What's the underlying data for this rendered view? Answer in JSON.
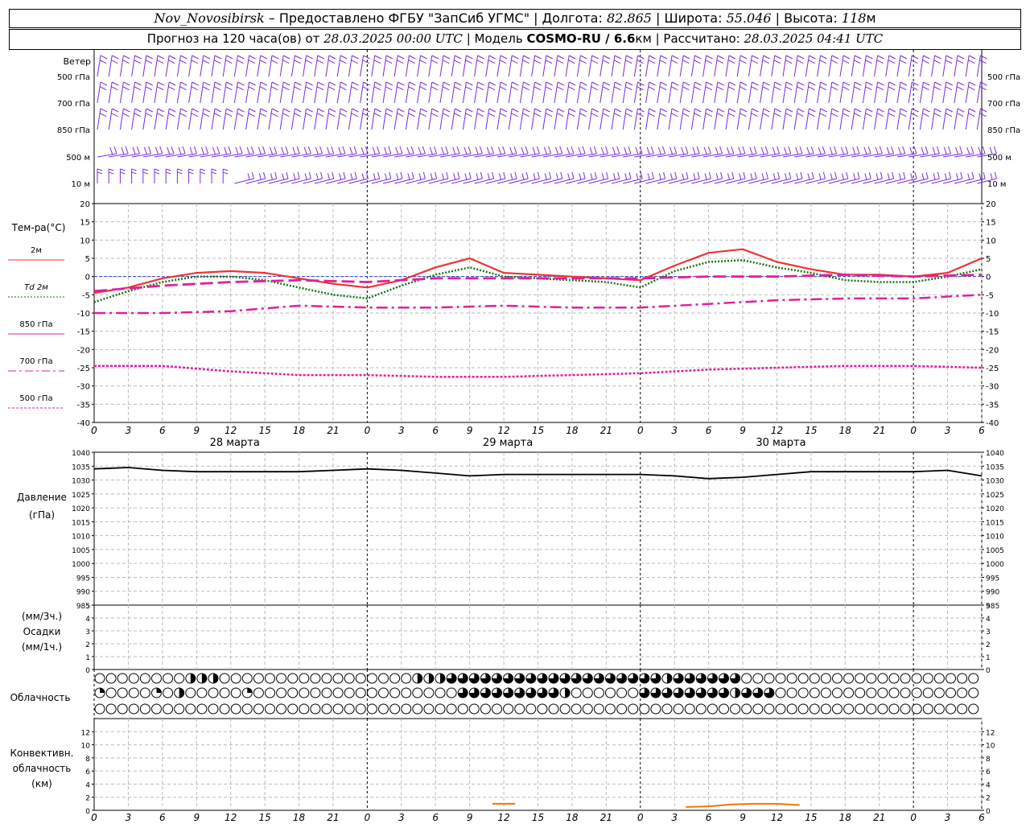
{
  "header": {
    "station": "Nov_Novosibirsk",
    "provider": " – Предоставлено ФГБУ \"ЗапСиб УГМС\" | Долгота: ",
    "lon": "82.865",
    "lat_label": " | Широта: ",
    "lat": "55.046",
    "alt_label": " | Высота: ",
    "alt": "118",
    "alt_unit": "м",
    "forecast_label": "Прогноз на 120 часа(ов) от ",
    "forecast_start": "28.03.2025 00:00 UTC",
    "model_label": " | Модель ",
    "model": "COSMO-RU / 6.6",
    "model_unit": "км",
    "computed_label": " | Рассчитано: ",
    "computed": "28.03.2025 04:41 UTC"
  },
  "labels": {
    "wind": "Ветер",
    "wind_levels": [
      "500 гПа",
      "700 гПа",
      "850 гПа",
      "500 м",
      "10 м"
    ],
    "temp": "Тем-ра(°C)",
    "legend": [
      "2м",
      "Td 2м",
      "850 гПа",
      "700 гПа",
      "500 гПа"
    ],
    "pressure": [
      "Давление",
      "(гПа)"
    ],
    "precip": [
      "(мм/3ч.)",
      "Осадки",
      "(мм/1ч.)"
    ],
    "cloud": "Облачность",
    "conv": [
      "Конвективн.",
      "облачность",
      "(км)"
    ]
  },
  "x_ticks": [
    "0",
    "3",
    "6",
    "9",
    "12",
    "15",
    "18",
    "21",
    "0",
    "3",
    "6",
    "9",
    "12",
    "15",
    "18",
    "21",
    "0",
    "3",
    "6",
    "9",
    "12",
    "15",
    "18",
    "21",
    "0",
    "3",
    "6"
  ],
  "dates": [
    "28 марта",
    "29 марта",
    "30 марта"
  ],
  "colors": {
    "wind": "#7a2be0",
    "t2m": "#ee3333",
    "td2m": "#117711",
    "t850": "#e0209a",
    "pressure": "#000000",
    "conv": "#ee7700"
  },
  "chart_data": [
    {
      "type": "line",
      "panel": "temperature",
      "ylim": [
        -40,
        20
      ],
      "yticks": [
        20,
        15,
        10,
        5,
        0,
        -5,
        -10,
        -15,
        -20,
        -25,
        -30,
        -35,
        -40
      ],
      "x_unit": "hours since 28.03.2025 00:00 UTC",
      "series": [
        {
          "name": "2м",
          "x": [
            0,
            3,
            6,
            9,
            12,
            15,
            18,
            21,
            24,
            27,
            30,
            33,
            36,
            39,
            42,
            45,
            48,
            51,
            54,
            57,
            60,
            63,
            66,
            69,
            72,
            75,
            78
          ],
          "values": [
            -4.5,
            -3.0,
            -0.5,
            1.0,
            1.5,
            1.0,
            -0.5,
            -2.0,
            -3.0,
            -1.0,
            2.5,
            5.0,
            1.0,
            0.5,
            0.0,
            -0.5,
            -1.0,
            3.0,
            6.5,
            7.5,
            4.0,
            2.0,
            0.5,
            0.5,
            0.0,
            1.0,
            5.0
          ]
        },
        {
          "name": "Td 2м",
          "x": [
            0,
            3,
            6,
            9,
            12,
            15,
            18,
            21,
            24,
            27,
            30,
            33,
            36,
            39,
            42,
            45,
            48,
            51,
            54,
            57,
            60,
            63,
            66,
            69,
            72,
            75,
            78
          ],
          "values": [
            -7.0,
            -4.0,
            -1.5,
            0.0,
            0.0,
            -1.0,
            -3.0,
            -5.0,
            -6.0,
            -2.5,
            0.5,
            2.5,
            0.0,
            -0.5,
            -1.0,
            -1.5,
            -3.0,
            1.5,
            4.0,
            4.5,
            2.5,
            1.0,
            -1.0,
            -1.5,
            -1.5,
            0.0,
            2.0
          ]
        },
        {
          "name": "850 гПа",
          "x": [
            0,
            6,
            12,
            18,
            24,
            30,
            36,
            42,
            48,
            54,
            60,
            66,
            72,
            78
          ],
          "values": [
            -4.0,
            -2.5,
            -1.5,
            -1.0,
            -1.5,
            -0.5,
            -0.5,
            -0.5,
            -0.5,
            0.0,
            0.0,
            0.5,
            0.0,
            0.5
          ]
        },
        {
          "name": "700 гПа",
          "x": [
            0,
            6,
            12,
            18,
            24,
            30,
            36,
            42,
            48,
            54,
            60,
            66,
            72,
            78
          ],
          "values": [
            -10.0,
            -10.0,
            -9.5,
            -8.0,
            -8.5,
            -8.5,
            -8.0,
            -8.5,
            -8.5,
            -7.5,
            -6.5,
            -6.0,
            -6.0,
            -5.0
          ]
        },
        {
          "name": "500 гПа",
          "x": [
            0,
            6,
            12,
            18,
            24,
            30,
            36,
            42,
            48,
            54,
            60,
            66,
            72,
            78
          ],
          "values": [
            -24.5,
            -24.5,
            -26.0,
            -27.0,
            -27.0,
            -27.5,
            -27.5,
            -27.0,
            -26.5,
            -25.5,
            -25.0,
            -24.5,
            -24.5,
            -25.0
          ]
        }
      ]
    },
    {
      "type": "line",
      "panel": "pressure",
      "ylim": [
        985,
        1040
      ],
      "yticks": [
        1040,
        1035,
        1030,
        1025,
        1020,
        1015,
        1010,
        1005,
        1000,
        995,
        990,
        985
      ],
      "series": [
        {
          "name": "Давление",
          "x": [
            0,
            3,
            6,
            9,
            12,
            15,
            18,
            21,
            24,
            27,
            30,
            33,
            36,
            39,
            42,
            45,
            48,
            51,
            54,
            57,
            60,
            63,
            66,
            69,
            72,
            75,
            78
          ],
          "values": [
            1034.0,
            1034.5,
            1033.5,
            1033.0,
            1033.0,
            1033.0,
            1033.0,
            1033.5,
            1034.0,
            1033.5,
            1032.5,
            1031.5,
            1032.0,
            1032.0,
            1032.0,
            1032.0,
            1032.0,
            1031.5,
            1030.5,
            1031.0,
            1032.0,
            1033.0,
            1033.0,
            1033.0,
            1033.0,
            1033.5,
            1031.5
          ]
        }
      ]
    },
    {
      "type": "bar",
      "panel": "precipitation",
      "ylim": [
        0,
        5
      ],
      "yticks": [
        5,
        4,
        3,
        2,
        1,
        0
      ],
      "values": []
    },
    {
      "type": "line",
      "panel": "convective_cloud",
      "ylim": [
        0,
        14
      ],
      "yticks": [
        12,
        10,
        8,
        6,
        4,
        2,
        0
      ],
      "series": [
        {
          "x": [
            35,
            37
          ],
          "values": [
            1.0,
            1.0
          ]
        },
        {
          "x": [
            52,
            54,
            56,
            58,
            60,
            62
          ],
          "values": [
            0.5,
            0.6,
            0.9,
            1.0,
            1.0,
            0.8
          ]
        }
      ]
    }
  ],
  "clouds": {
    "rows": [
      {
        "name": "upper",
        "values": [
          0,
          0,
          0,
          0,
          0,
          0,
          0,
          0,
          0.5,
          0.5,
          0.5,
          0,
          0,
          0,
          0,
          0,
          0,
          0,
          0,
          0,
          0,
          0,
          0,
          0,
          0,
          0,
          0,
          0,
          0.5,
          0.5,
          0.5,
          0.75,
          0.75,
          0.75,
          0.75,
          0.75,
          0.75,
          0.75,
          0.75,
          0.75,
          0.75,
          0.75,
          0.75,
          0.75,
          0.75,
          0.75,
          0.75,
          0.75,
          0.75,
          0.75,
          0.5,
          0.75,
          0.75,
          0.75,
          0.75,
          0.75,
          0.75,
          0,
          0,
          0,
          0,
          0,
          0,
          0,
          0,
          0,
          0,
          0,
          0,
          0,
          0,
          0,
          0,
          0,
          0,
          0,
          0,
          0,
          0,
          0
        ]
      },
      {
        "name": "middle",
        "values": [
          0.25,
          0,
          0,
          0,
          0,
          0.25,
          0,
          0.5,
          0,
          0,
          0,
          0,
          0,
          0.25,
          0,
          0,
          0,
          0,
          0,
          0,
          0,
          0,
          0,
          0,
          0,
          0,
          0,
          0,
          0,
          0,
          0,
          0,
          0.75,
          0.75,
          0.75,
          0.75,
          0.75,
          0.75,
          0.75,
          0.75,
          0.75,
          0.5,
          0,
          0,
          0,
          0,
          0,
          0,
          0.75,
          0.75,
          0.75,
          0.75,
          0.75,
          0.75,
          0.75,
          0.75,
          0.5,
          0.75,
          0.75,
          0.75,
          0,
          0,
          0,
          0,
          0,
          0,
          0,
          0,
          0,
          0,
          0,
          0,
          0,
          0,
          0,
          0,
          0,
          0,
          0,
          0
        ]
      },
      {
        "name": "lower",
        "values": [
          0,
          0,
          0,
          0,
          0,
          0,
          0,
          0,
          0,
          0,
          0,
          0,
          0,
          0,
          0,
          0,
          0,
          0,
          0,
          0,
          0,
          0,
          0,
          0,
          0,
          0,
          0,
          0,
          0,
          0,
          0,
          0,
          0,
          0,
          0,
          0,
          0,
          0,
          0,
          0,
          0,
          0,
          0,
          0,
          0,
          0,
          0,
          0,
          0,
          0,
          0,
          0,
          0,
          0,
          0,
          0,
          0,
          0,
          0,
          0,
          0,
          0,
          0,
          0,
          0,
          0,
          0,
          0,
          0,
          0,
          0,
          0,
          0,
          0,
          0,
          0,
          0,
          0,
          0,
          0
        ]
      }
    ]
  }
}
